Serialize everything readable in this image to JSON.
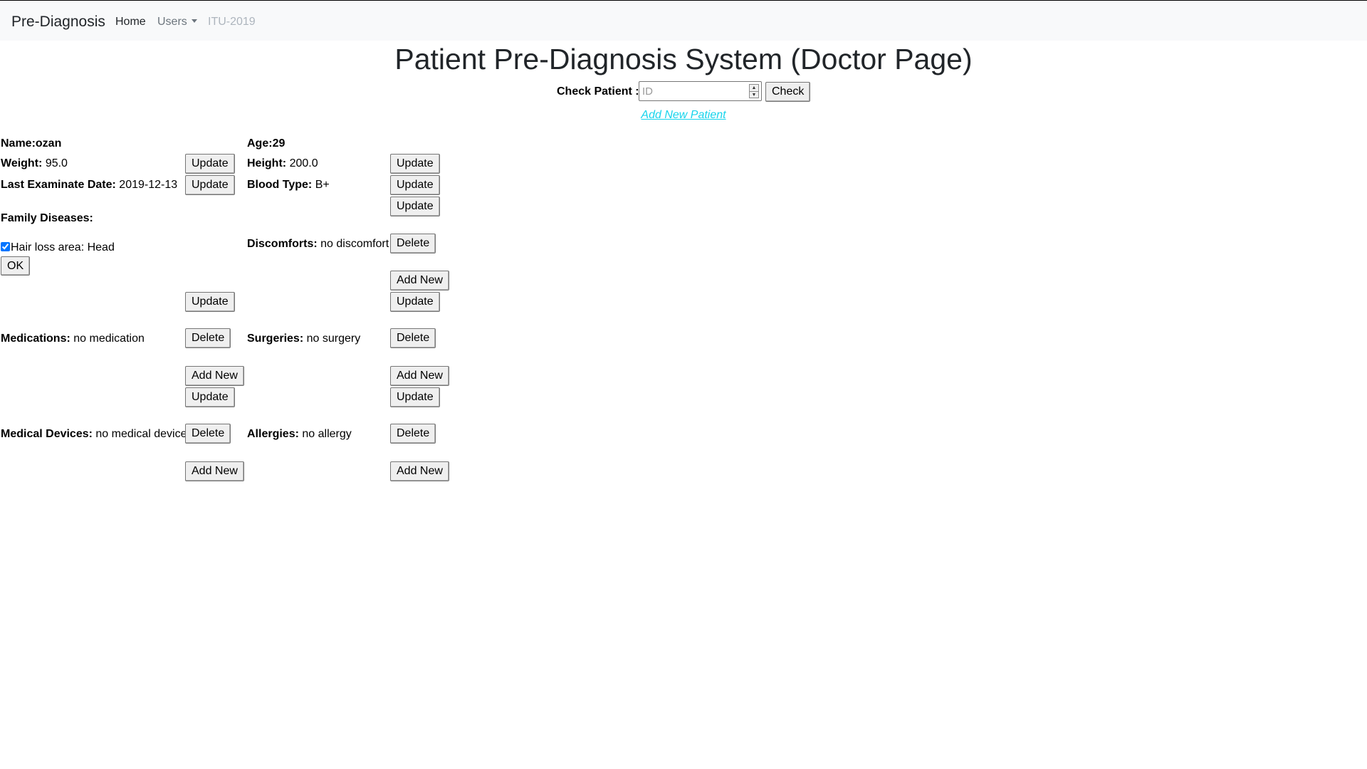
{
  "navbar": {
    "brand": "Pre-Diagnosis",
    "home": "Home",
    "users": "Users",
    "itu": "ITU-2019"
  },
  "header": {
    "title": "Patient Pre-Diagnosis System (Doctor Page)",
    "check_label": "Check Patient :",
    "id_placeholder": "ID",
    "check_button": "Check",
    "add_new_patient": "Add New Patient"
  },
  "patient": {
    "name_label": "Name:",
    "name_value": "ozan",
    "age_label": "Age:",
    "age_value": "29",
    "weight_label": "Weight:",
    "weight_value": "95.0",
    "height_label": "Height:",
    "height_value": "200.0",
    "last_exam_label": "Last Examinate Date:",
    "last_exam_value": "2019-12-13",
    "blood_type_label": "Blood Type:",
    "blood_type_value": "B+",
    "family_diseases_label": "Family Diseases:",
    "family_disease_item": "Hair loss area: Head",
    "family_disease_checked": true,
    "discomforts_label": "Discomforts:",
    "discomforts_value": "no discomfort",
    "medications_label": "Medications:",
    "medications_value": "no medication",
    "surgeries_label": "Surgeries:",
    "surgeries_value": "no surgery",
    "medical_devices_label": "Medical Devices:",
    "medical_devices_value": "no medical device",
    "allergies_label": "Allergies:",
    "allergies_value": "no allergy"
  },
  "buttons": {
    "update": "Update",
    "delete": "Delete",
    "add_new": "Add New",
    "ok": "OK"
  },
  "colors": {
    "navbar_bg": "#f8f9fa",
    "link": "#17d4ec",
    "button_bg": "#efefef"
  }
}
